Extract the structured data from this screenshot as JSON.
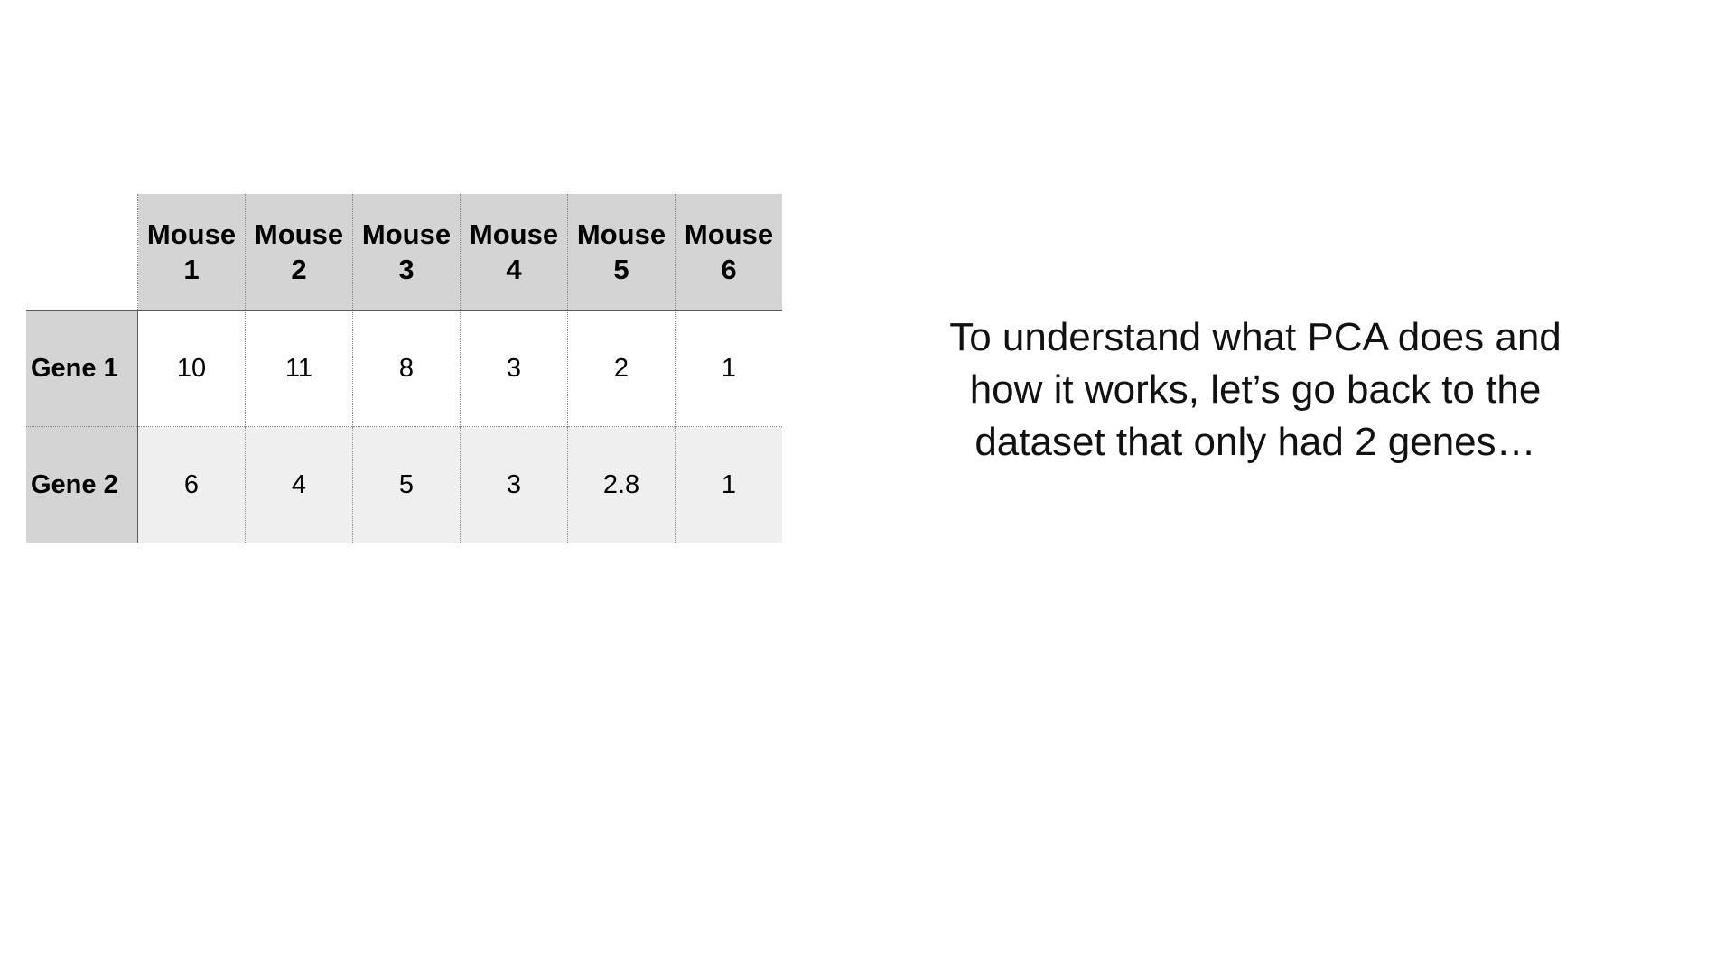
{
  "table": {
    "columns": [
      "Mouse 1",
      "Mouse 2",
      "Mouse 3",
      "Mouse 4",
      "Mouse 5",
      "Mouse 6"
    ],
    "column_headers": [
      {
        "line1": "Mouse",
        "line2": "1"
      },
      {
        "line1": "Mouse",
        "line2": "2"
      },
      {
        "line1": "Mouse",
        "line2": "3"
      },
      {
        "line1": "Mouse",
        "line2": "4"
      },
      {
        "line1": "Mouse",
        "line2": "5"
      },
      {
        "line1": "Mouse",
        "line2": "6"
      }
    ],
    "rows": [
      {
        "label": "Gene 1",
        "values": [
          "10",
          "11",
          "8",
          "3",
          "2",
          "1"
        ]
      },
      {
        "label": "Gene 2",
        "values": [
          "6",
          "4",
          "5",
          "3",
          "2.8",
          "1"
        ]
      }
    ]
  },
  "caption": {
    "line1": "To understand what PCA does and",
    "line2": "how it works, let’s go back to the",
    "line3": "dataset that only had 2 genes…"
  },
  "colors": {
    "header_bg": "#d4d4d4",
    "row_alt_bg": "#efefef",
    "text": "#000000"
  }
}
